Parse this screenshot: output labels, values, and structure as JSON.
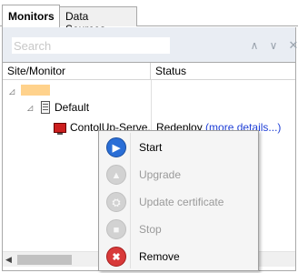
{
  "tabs": [
    {
      "label": "Monitors"
    },
    {
      "label": "Data Sources"
    }
  ],
  "search": {
    "placeholder": "Search",
    "value": ""
  },
  "toolbar": {
    "up_icon": "chevron-up-icon",
    "down_icon": "chevron-down-icon",
    "clear_icon": "close-icon"
  },
  "grid": {
    "columns": [
      "Site/Monitor",
      "Status"
    ],
    "tree": {
      "root": {
        "label": ""
      },
      "default_group": {
        "label": "Default"
      },
      "monitor": {
        "label": "ContolUp-Serve...",
        "status": "Redeploy",
        "status_link": "(more details...)"
      }
    }
  },
  "context_menu": {
    "items": [
      {
        "label": "Start",
        "enabled": true,
        "icon": "play-icon"
      },
      {
        "label": "Upgrade",
        "enabled": false,
        "icon": "upgrade-icon"
      },
      {
        "label": "Update certificate",
        "enabled": false,
        "icon": "certificate-icon"
      },
      {
        "label": "Stop",
        "enabled": false,
        "icon": "stop-icon"
      },
      {
        "label": "Remove",
        "enabled": true,
        "icon": "remove-icon"
      }
    ]
  },
  "colors": {
    "accent_blue": "#2a6ed6",
    "remove_red": "#d83a3a",
    "link": "#1f3fd6",
    "site_highlight": "#ffd28c"
  }
}
